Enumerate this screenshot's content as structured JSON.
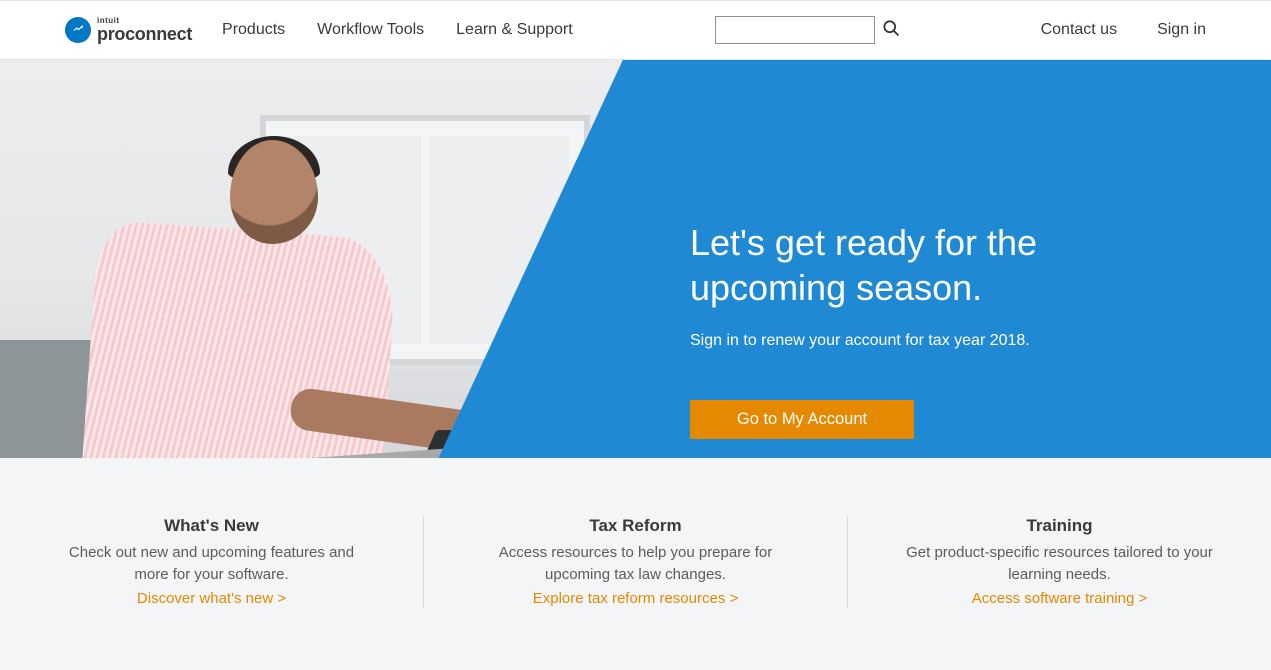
{
  "brand": {
    "super": "intuit",
    "name": "proconnect"
  },
  "nav": {
    "products": "Products",
    "workflow": "Workflow Tools",
    "learn": "Learn & Support"
  },
  "header_links": {
    "contact": "Contact us",
    "signin": "Sign in"
  },
  "hero": {
    "title_l1": "Let's get ready for the",
    "title_l2": "upcoming season.",
    "subtitle": "Sign in to renew your account for tax year 2018.",
    "cta": "Go to My Account"
  },
  "cards": {
    "whats_new": {
      "title": "What's New",
      "body": "Check out new and upcoming features and more for your software.",
      "link": "Discover what's new >"
    },
    "tax_reform": {
      "title": "Tax Reform",
      "body": "Access resources to help you prepare for upcoming tax law changes.",
      "link": "Explore tax reform resources >"
    },
    "training": {
      "title": "Training",
      "body": "Get product-specific resources tailored to your learning needs.",
      "link": "Access software training >"
    }
  }
}
